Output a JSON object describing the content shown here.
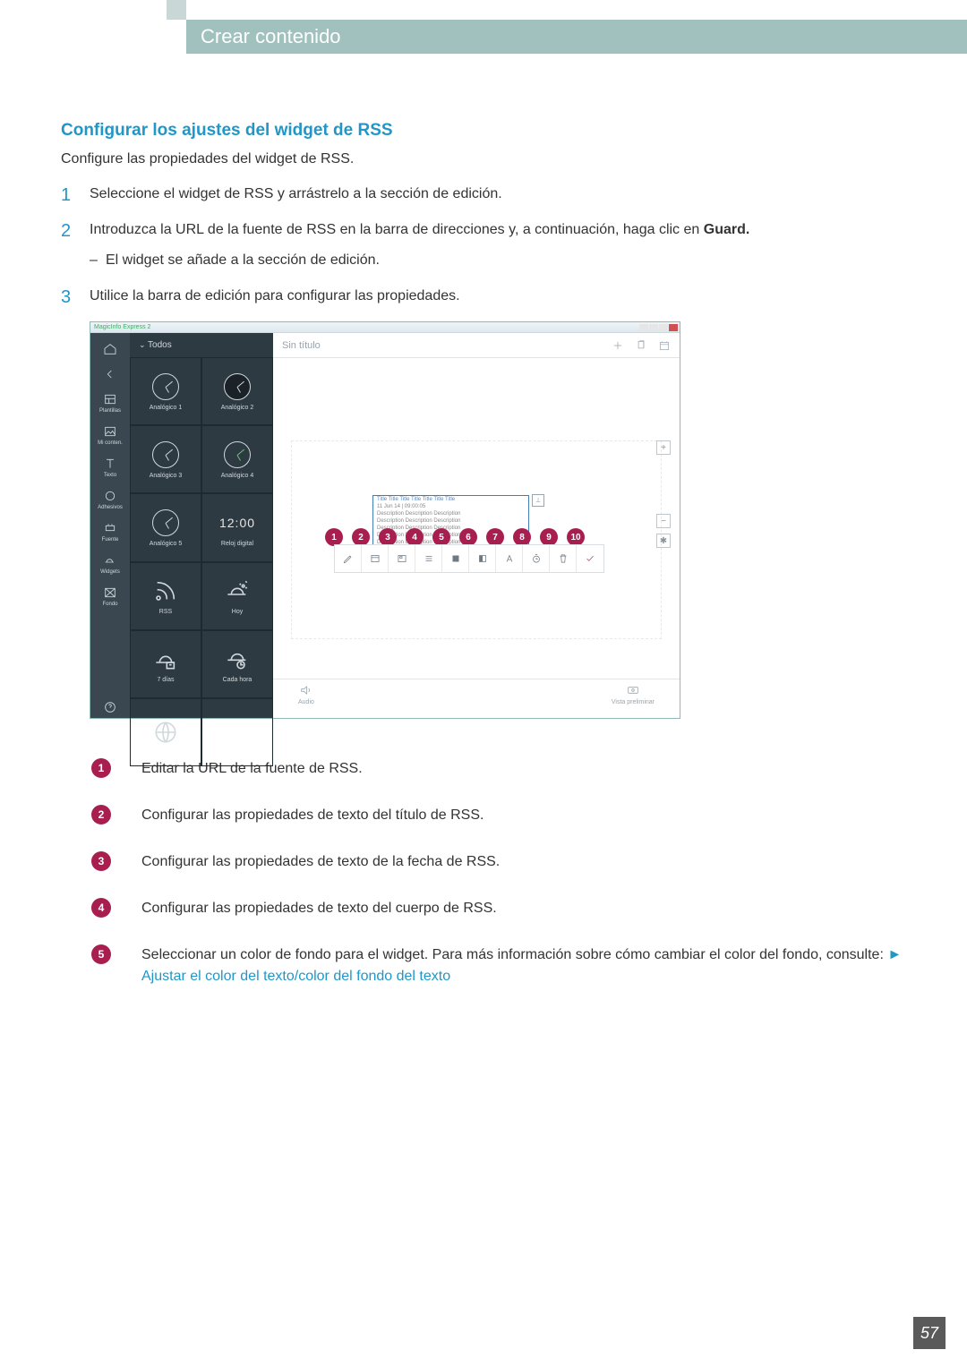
{
  "header": {
    "chapter": "Crear contenido"
  },
  "section": {
    "title": "Configurar los ajustes del widget de RSS",
    "intro": "Configure las propiedades del widget de RSS."
  },
  "steps": [
    {
      "text": "Seleccione el widget de RSS y arrástrelo a la sección de edición."
    },
    {
      "text_pre": "Introduzca la URL de la fuente de RSS en la barra de direcciones y, a continuación, haga clic en ",
      "bold": "Guard.",
      "sub": "El widget se añade a la sección de edición."
    },
    {
      "text": "Utilice la barra de edición para configurar las propiedades."
    }
  ],
  "screenshot": {
    "window_title": "MagicInfo Express 2",
    "panel": {
      "filter": "Todos",
      "widgets": [
        "Analógico 1",
        "Analógico 2",
        "Analógico 3",
        "Analógico 4",
        "Analógico 5",
        "Reloj digital",
        "RSS",
        "Hoy",
        "7 días",
        "Cada hora"
      ],
      "digital_time": "12:00"
    },
    "rail": [
      "",
      "",
      "Plantillas",
      "Mi conten.",
      "Texto",
      "Adhesivos",
      "Fuente",
      "Widgets",
      "Fondo"
    ],
    "canvas": {
      "title": "Sin título",
      "rss_sample": {
        "title_line": "Title Title Title Title Title Title Title",
        "date_line": "11 Jun 14 | 09:00:05",
        "body_lines": [
          "Description Description Description",
          "Description Description Description",
          "Description Description Description",
          "Description Description Description",
          "Description Description Description"
        ]
      },
      "bottom": {
        "audio": "Audio",
        "preview": "Vista preliminar"
      }
    },
    "callout_numbers": [
      "1",
      "2",
      "3",
      "4",
      "5",
      "6",
      "7",
      "8",
      "9",
      "10"
    ]
  },
  "legend": [
    {
      "n": "1",
      "text": "Editar la URL de la fuente de RSS."
    },
    {
      "n": "2",
      "text": "Configurar las propiedades de texto del título de RSS."
    },
    {
      "n": "3",
      "text": "Configurar las propiedades de texto de la fecha de RSS."
    },
    {
      "n": "4",
      "text": "Configurar las propiedades de texto del cuerpo de RSS."
    },
    {
      "n": "5",
      "text_pre": "Seleccionar un color de fondo para el widget. Para más información sobre cómo cambiar el color del fondo, consulte:   ",
      "link": "Ajustar el color del texto/color del fondo del texto"
    }
  ],
  "page_number": "57"
}
